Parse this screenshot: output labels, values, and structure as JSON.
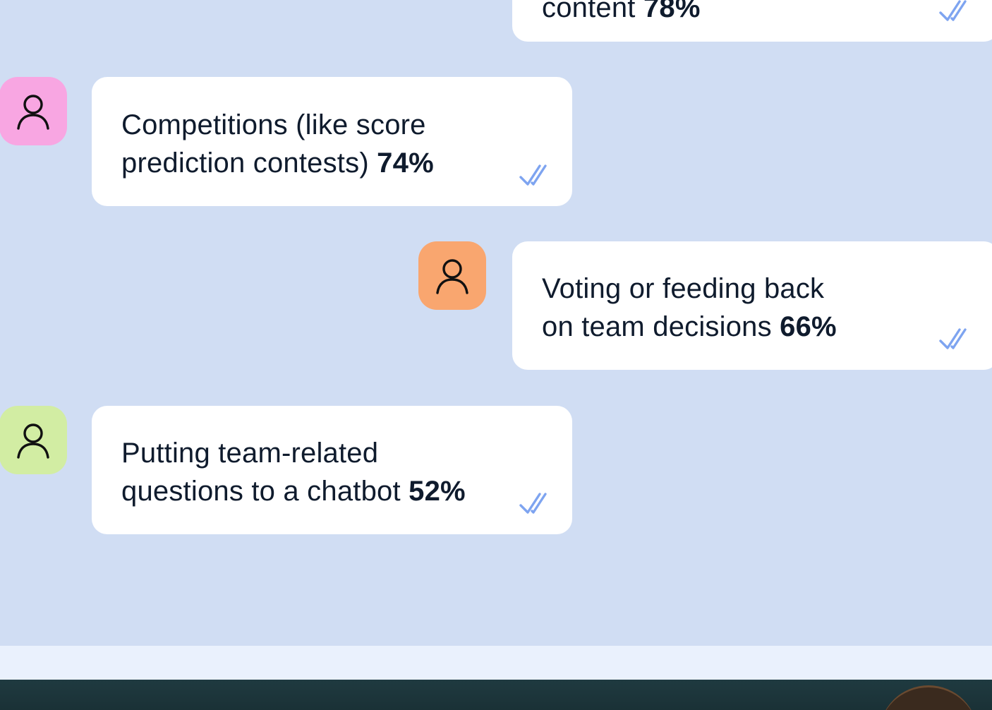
{
  "colors": {
    "chat_background": "#d0ddf3",
    "bubble": "#ffffff",
    "check": "#7ea4f0",
    "strip": "#eaf1fd",
    "photo": "#1f3a40"
  },
  "messages": [
    {
      "id": "m1",
      "side": "right",
      "text": "content",
      "stat": "78%",
      "avatar_color": null
    },
    {
      "id": "m2",
      "side": "left",
      "line1": "Competitions (like score",
      "line2": "prediction contests)",
      "stat": "74%",
      "avatar_color": "#f8a6e2",
      "avatar_icon": "user-icon"
    },
    {
      "id": "m3",
      "side": "right",
      "line1": "Voting or feeding back",
      "line2": "on team decisions",
      "stat": "66%",
      "avatar_color": "#f9a66f",
      "avatar_icon": "user-icon"
    },
    {
      "id": "m4",
      "side": "left",
      "line1": "Putting team-related",
      "line2": "questions to a chatbot",
      "stat": "52%",
      "avatar_color": "#d2eda3",
      "avatar_icon": "user-icon"
    }
  ],
  "read_receipt_icon": "double-check-icon"
}
